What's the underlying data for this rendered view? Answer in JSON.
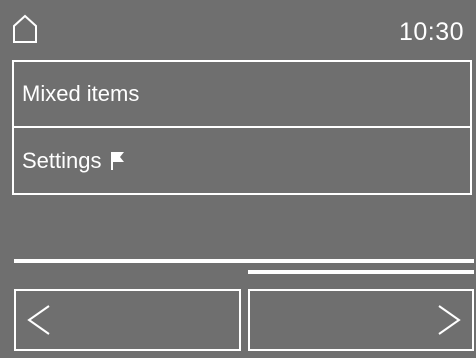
{
  "header": {
    "home_icon": "home-icon",
    "time": "10:30"
  },
  "menu": {
    "items": [
      {
        "label": "Mixed items"
      },
      {
        "label": "Settings",
        "icon": "flag-icon"
      }
    ]
  },
  "navigation": {
    "back_icon": "chevron-left-icon",
    "next_icon": "chevron-right-icon"
  },
  "colors": {
    "background": "#6f6f6f",
    "foreground": "#ffffff"
  }
}
